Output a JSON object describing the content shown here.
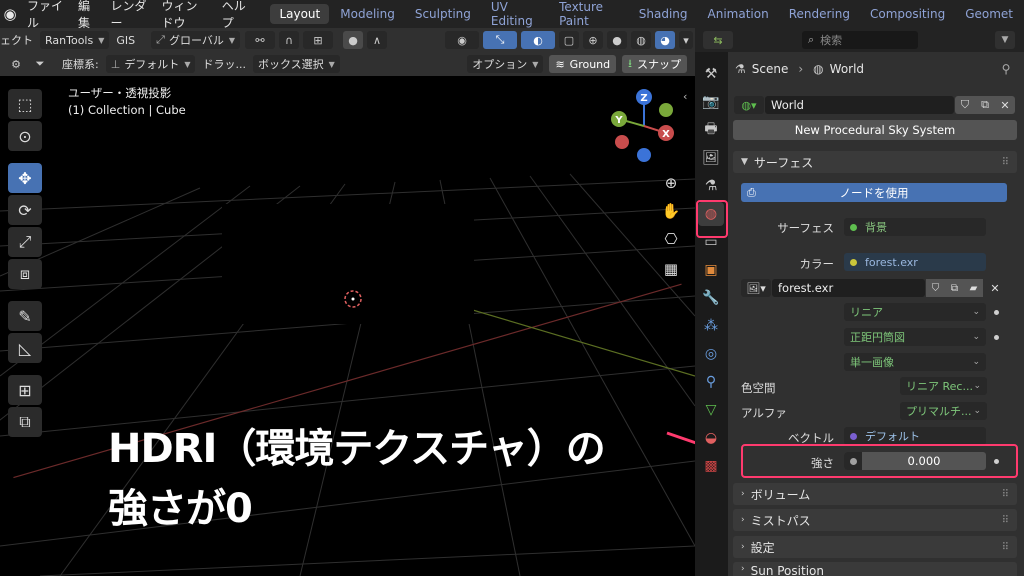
{
  "menubar": {
    "items": [
      "ファイル",
      "編集",
      "レンダー",
      "ウィンドウ",
      "ヘルプ"
    ],
    "workspaces": [
      "Layout",
      "Modeling",
      "Sculpting",
      "UV Editing",
      "Texture Paint",
      "Shading",
      "Animation",
      "Rendering",
      "Compositing",
      "Geomet"
    ]
  },
  "header2": {
    "left_clip": "ェクト",
    "rantools": "RanTools",
    "gis": "GIS",
    "global": "グローバル"
  },
  "header3": {
    "coord_label": "座標系:",
    "coord_value": "デフォルト",
    "drag_label": "ドラッ...",
    "drag_value": "ボックス選択",
    "options": "オプション",
    "ground": "Ground",
    "snap": "スナップ"
  },
  "viewport": {
    "view_name": "ユーザー・透視投影",
    "collection": "(1) Collection | Cube",
    "gizmo": {
      "z": "Z",
      "y": "Y",
      "x": "X"
    }
  },
  "annotation": {
    "line1": "HDRI（環境テクスチャ）の",
    "line2": "強さが0",
    "color": "#ff3a6e"
  },
  "props": {
    "search_placeholder": "検索",
    "scene": "Scene",
    "world": "World",
    "world_name": "World",
    "sky_button": "New Procedural Sky System",
    "surface_panel": "サーフェス",
    "use_nodes": "ノードを使用",
    "surface_label": "サーフェス",
    "surface_value": "背景",
    "color_label": "カラー",
    "color_value": "forest.exr",
    "image_name": "forest.exr",
    "interp": "リニア",
    "projection": "正距円筒図",
    "source": "単一画像",
    "colorspace_label": "色空間",
    "colorspace_value": "リニア Rec...",
    "alpha_label": "アルファ",
    "alpha_value": "プリマルチ...",
    "vector_label": "ベクトル",
    "vector_value": "デフォルト",
    "strength_label": "強さ",
    "strength_value": "0.000",
    "panels": [
      "ボリューム",
      "ミストパス",
      "設定",
      "Sun Position"
    ]
  },
  "colors": {
    "accent": "#4772b3",
    "highlight": "#ff3a6e",
    "socket_green": "#5fbf4f",
    "socket_yellow": "#c9c53a",
    "socket_purple": "#7a5fd0",
    "socket_gray": "#a1a1a1"
  }
}
